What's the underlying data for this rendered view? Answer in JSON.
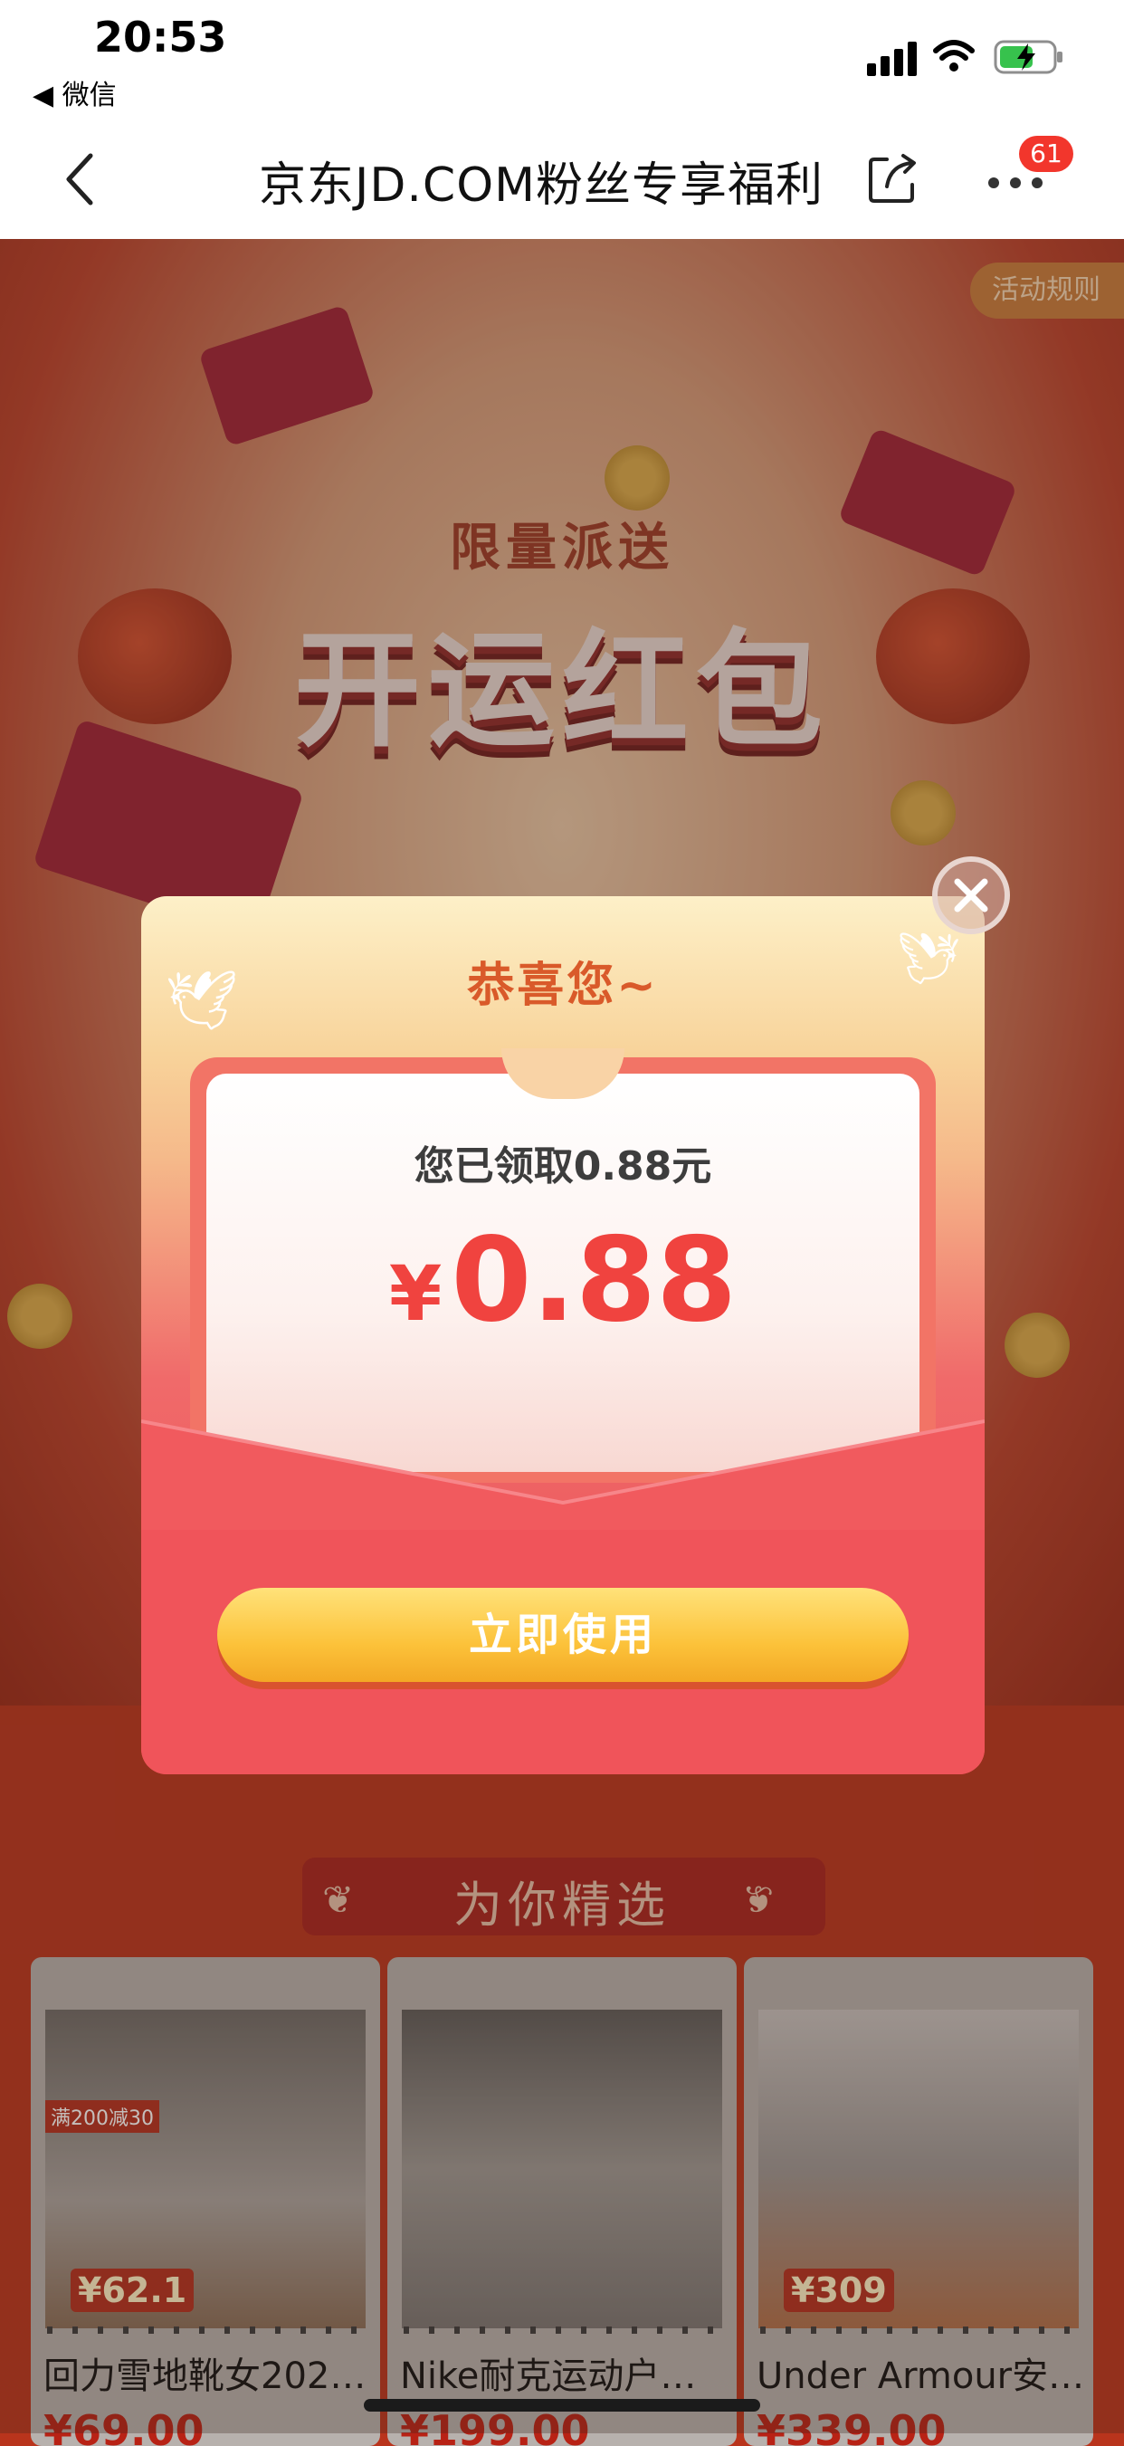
{
  "status_bar": {
    "time": "20:53",
    "back_label": "◀ 微信"
  },
  "nav": {
    "title": "京东JD.COM粉丝专享福利",
    "badge": "61"
  },
  "hero": {
    "rules": "活动规则",
    "subtitle": "限量派送",
    "title": "开运红包"
  },
  "section": {
    "title": "为你精选"
  },
  "products": [
    {
      "name": "回力雪地靴女202…",
      "price": "¥69.00",
      "img_price": "¥62.1",
      "img_tag": "满200减30"
    },
    {
      "name": "Nike耐克运动户…",
      "price": "¥199.00",
      "img_price": "",
      "img_tag": ""
    },
    {
      "name": "Under Armour安…",
      "price": "¥339.00",
      "img_price": "¥309",
      "img_tag": ""
    }
  ],
  "modal": {
    "title": "恭喜您~",
    "received": "您已领取0.88元",
    "currency": "¥",
    "amount": "0.88",
    "button": "立即使用"
  },
  "colors": {
    "accent_red": "#f0433f",
    "button_yellow": "#fcc23a",
    "badge_red": "#f2362c"
  }
}
